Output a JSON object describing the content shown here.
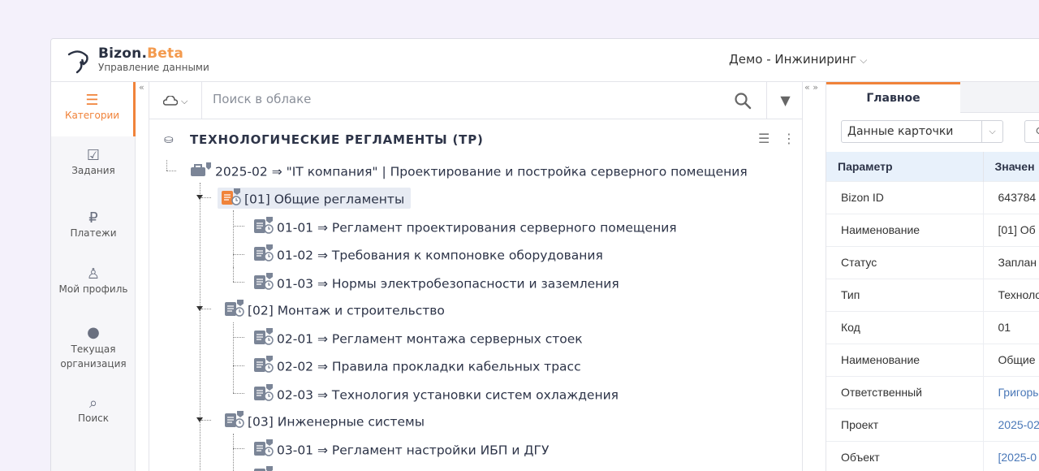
{
  "brand": {
    "name_main": "Bizon.",
    "name_beta": "Beta",
    "subtitle": "Управление данными"
  },
  "header": {
    "org_selector": "Демо - Инжиниринг"
  },
  "sidebar": {
    "items": [
      {
        "label": "Категории",
        "icon": "menu-icon",
        "active": true
      },
      {
        "label": "Задания",
        "icon": "checkbox-icon"
      },
      {
        "label": "Платежи",
        "icon": "ruble-icon"
      },
      {
        "label": "Мой профиль",
        "icon": "user-icon"
      },
      {
        "label": "Текущая организация",
        "icon": "pin-icon"
      },
      {
        "label": "Поиск",
        "icon": "search-icon"
      }
    ]
  },
  "search": {
    "placeholder": "Поиск в облаке"
  },
  "tree": {
    "title": "ТЕХНОЛОГИЧЕСКИЕ РЕГЛАМЕНТЫ (ТР)",
    "root": "2025-02 ⇒ \"IT компания\" | Проектирование и постройка серверного помещения",
    "groups": [
      {
        "label": "[01] Общие регламенты",
        "selected": true,
        "children": [
          "01-01 ⇒ Регламент проектирования серверного помещения",
          "01-02 ⇒ Требования к компоновке оборудования",
          "01-03 ⇒ Нормы электробезопасности и заземления"
        ]
      },
      {
        "label": "[02] Монтаж и строительство",
        "children": [
          "02-01 ⇒ Регламент монтажа серверных стоек",
          "02-02 ⇒ Правила прокладки кабельных трасс",
          "02-03 ⇒ Технология установки систем охлаждения"
        ]
      },
      {
        "label": "[03] Инженерные системы",
        "children": [
          "03-01 ⇒ Регламент настройки ИБП и ДГУ"
        ]
      }
    ]
  },
  "details": {
    "tab": "Главное",
    "card_select": "Данные карточки",
    "headers": [
      "Параметр",
      "Значен"
    ],
    "rows": [
      {
        "param": "Bizon ID",
        "value": "643784"
      },
      {
        "param": "Наименование",
        "value": "[01] Об"
      },
      {
        "param": "Статус",
        "value": "Заплан"
      },
      {
        "param": "Тип",
        "value": "Техноло"
      },
      {
        "param": "Код",
        "value": "01"
      },
      {
        "param": "Наименование",
        "value": "Общие"
      },
      {
        "param": "Ответственный",
        "value": "Григоры",
        "link": true
      },
      {
        "param": "Проект",
        "value": "2025-02",
        "link": true
      },
      {
        "param": "Объект",
        "value": "[2025-0",
        "link": true
      }
    ]
  },
  "colors": {
    "accent": "#f0833a",
    "link": "#4a78b8",
    "tree_icon": "#7b8597"
  }
}
